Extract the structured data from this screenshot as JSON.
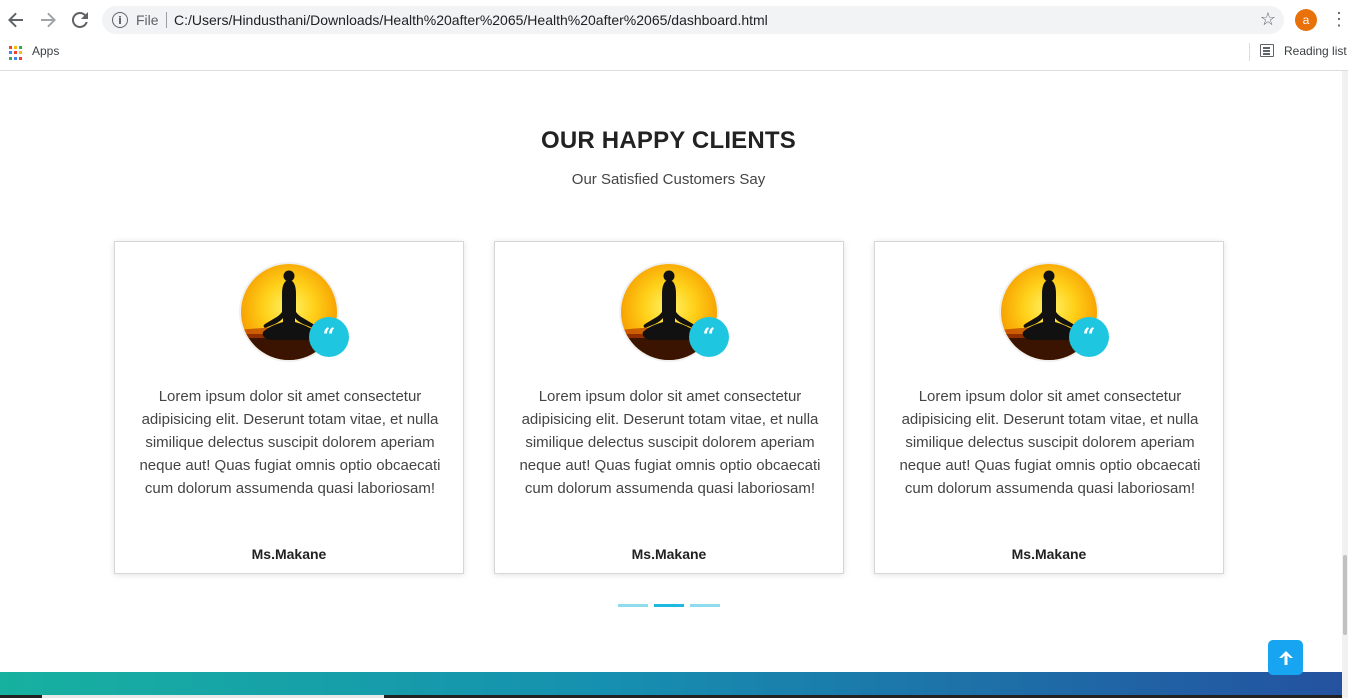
{
  "browser": {
    "file_label": "File",
    "url": "C:/Users/Hindusthani/Downloads/Health%20after%2065/Health%20after%2065/dashboard.html",
    "avatar_letter": "a",
    "apps_label": "Apps",
    "reading_list_label": "Reading list"
  },
  "section": {
    "title": "OUR HAPPY CLIENTS",
    "subtitle": "Our Satisfied Customers Say"
  },
  "testimonials": [
    {
      "text": "Lorem ipsum dolor sit amet consectetur adipisicing elit. Deserunt totam vitae, et nulla similique delectus suscipit dolorem aperiam neque aut! Quas fugiat omnis optio obcaecati cum dolorum assumenda quasi laboriosam!",
      "name": "Ms.Makane"
    },
    {
      "text": "Lorem ipsum dolor sit amet consectetur adipisicing elit. Deserunt totam vitae, et nulla similique delectus suscipit dolorem aperiam neque aut! Quas fugiat omnis optio obcaecati cum dolorum assumenda quasi laboriosam!",
      "name": "Ms.Makane"
    },
    {
      "text": "Lorem ipsum dolor sit amet consectetur adipisicing elit. Deserunt totam vitae, et nulla similique delectus suscipit dolorem aperiam neque aut! Quas fugiat omnis optio obcaecati cum dolorum assumenda quasi laboriosam!",
      "name": "Ms.Makane"
    }
  ],
  "quote_glyph": "“",
  "carousel": {
    "active_index": 1,
    "count": 3
  },
  "colors": {
    "accent": "#1fc6e0",
    "back_to_top": "#17a4f0"
  },
  "icons": {
    "back": "back-arrow-icon",
    "forward": "forward-arrow-icon",
    "reload": "reload-icon",
    "info": "info-icon",
    "star": "star-icon",
    "menu": "kebab-menu-icon",
    "apps": "apps-grid-icon",
    "reading_list": "reading-list-icon",
    "quote": "quote-icon",
    "back_to_top": "arrow-up-icon"
  }
}
